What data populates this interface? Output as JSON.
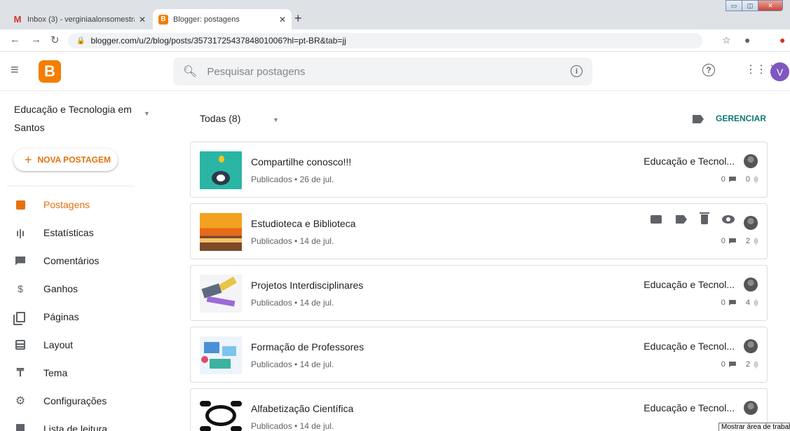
{
  "browser": {
    "tabs": [
      {
        "title": "Inbox (3) - verginiaalonsomestra",
        "icon": "gmail-icon"
      },
      {
        "title": "Blogger: postagens",
        "icon": "blogger-icon"
      }
    ],
    "url": "blogger.com/u/2/blog/posts/3573172543784801006?hl=pt-BR&tab=jj"
  },
  "header": {
    "search_placeholder": "Pesquisar postagens",
    "avatar_letter": "V"
  },
  "sidebar": {
    "blog_name": "Educação e Tecnologia em Santos",
    "new_post_label": "NOVA POSTAGEM",
    "items": [
      {
        "label": "Postagens",
        "icon": "posts-icon",
        "active": true
      },
      {
        "label": "Estatísticas",
        "icon": "stats-icon"
      },
      {
        "label": "Comentários",
        "icon": "comments-icon"
      },
      {
        "label": "Ganhos",
        "icon": "dollar-icon"
      },
      {
        "label": "Páginas",
        "icon": "pages-icon"
      },
      {
        "label": "Layout",
        "icon": "layout-icon"
      },
      {
        "label": "Tema",
        "icon": "theme-icon"
      },
      {
        "label": "Configurações",
        "icon": "gear-icon"
      },
      {
        "label": "Lista de leitura",
        "icon": "reading-list-icon"
      }
    ]
  },
  "main": {
    "filter_label": "Todas (8)",
    "manage_label": "GERENCIAR",
    "posts": [
      {
        "title": "Compartilhe conosco!!!",
        "meta": "Publicados • 26 de jul.",
        "author": "Educação e Tecnol...",
        "comments": "0",
        "views": "0"
      },
      {
        "title": "Estudioteca e Biblioteca",
        "meta": "Publicados • 14 de jul.",
        "author": "",
        "comments": "0",
        "views": "2"
      },
      {
        "title": "Projetos Interdisciplinares",
        "meta": "Publicados • 14 de jul.",
        "author": "Educação e Tecnol...",
        "comments": "0",
        "views": "4"
      },
      {
        "title": "Formação de Professores",
        "meta": "Publicados • 14 de jul.",
        "author": "Educação e Tecnol...",
        "comments": "0",
        "views": "2"
      },
      {
        "title": "Alfabetização Científica",
        "meta": "Publicados • 14 de jul.",
        "author": "Educação e Tecnol...",
        "comments": "",
        "views": ""
      }
    ]
  },
  "tooltip": "Mostrar área de trabalh",
  "colors": {
    "accent": "#e8710a",
    "brand": "#f57d00",
    "avatar": "#7e57c2"
  }
}
